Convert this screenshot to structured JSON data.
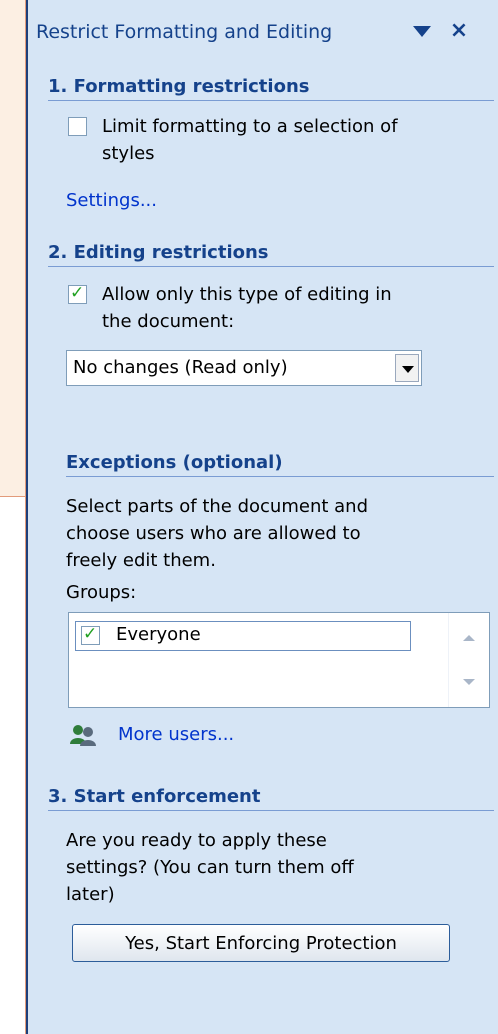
{
  "pane": {
    "title": "Restrict Formatting and Editing",
    "dropdown_icon": "triangle-down-icon",
    "close_icon": "close-icon",
    "close_glyph": "×"
  },
  "formatting": {
    "heading": "1. Formatting restrictions",
    "checkbox_line1": "Limit formatting to a selection of",
    "checkbox_line2": "styles",
    "checkbox_checked": false,
    "settings_link": "Settings..."
  },
  "editing": {
    "heading": "2. Editing restrictions",
    "checkbox_line1": "Allow only this type of editing in",
    "checkbox_line2": "the document:",
    "checkbox_checked": true,
    "selected_option": "No changes (Read only)"
  },
  "exceptions": {
    "heading": "Exceptions (optional)",
    "desc_line1": "Select parts of the document and",
    "desc_line2": "choose users who are allowed to",
    "desc_line3": "freely edit them.",
    "groups_label": "Groups:",
    "groups": [
      {
        "name": "Everyone",
        "checked": true
      }
    ],
    "more_users_link": "More users...",
    "users_icon": "users-icon"
  },
  "enforcement": {
    "heading": "3. Start enforcement",
    "desc_line1": "Are you ready to apply these",
    "desc_line2": "settings? (You can turn them off",
    "desc_line3": "later)",
    "button_label": "Yes, Start Enforcing Protection"
  },
  "colors": {
    "pane_bg": "#d6e5f5",
    "heading": "#15428b",
    "link": "#0033cc",
    "document_tint": "#fcefe3"
  }
}
